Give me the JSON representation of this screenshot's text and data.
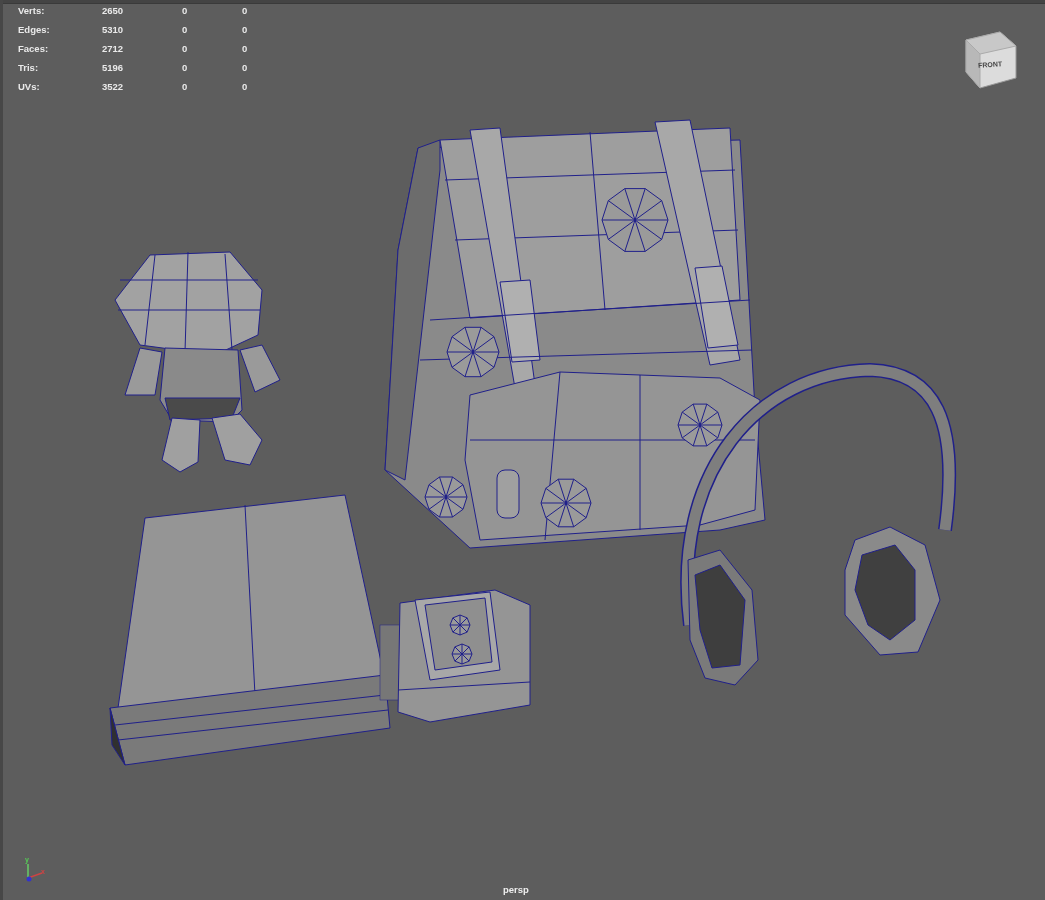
{
  "hud_stats": [
    {
      "label": "Verts:",
      "value": "2650",
      "column_3": "0",
      "column_4": "0"
    },
    {
      "label": "Edges:",
      "value": "5310",
      "column_3": "0",
      "column_4": "0"
    },
    {
      "label": "Faces:",
      "value": "2712",
      "column_3": "0",
      "column_4": "0"
    },
    {
      "label": "Tris:",
      "value": "5196",
      "column_3": "0",
      "column_4": "0"
    },
    {
      "label": "UVs:",
      "value": "3522",
      "column_3": "0",
      "column_4": "0"
    }
  ],
  "view_cube": {
    "face_label": "FRONT"
  },
  "axis_gizmo": {
    "y_label": "y",
    "x_label": "x"
  },
  "camera_label": "persp"
}
